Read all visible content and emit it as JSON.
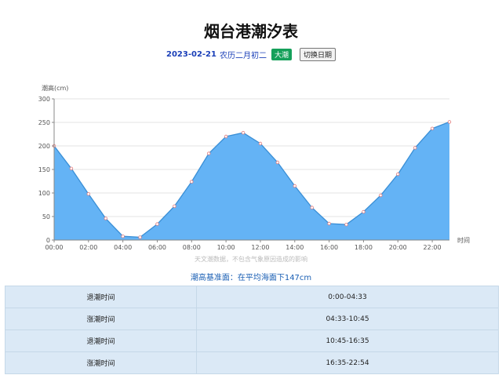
{
  "header": {
    "title": "烟台港潮汐表",
    "date": "2023-02-21",
    "lunar": "农历二月初二",
    "tide_badge": "大潮",
    "switch_button": "切换日期"
  },
  "chart_data": {
    "type": "area",
    "ylabel": "潮高(cm)",
    "xlabel": "时间",
    "ylim": [
      0,
      300
    ],
    "yticks": [
      "0",
      "50",
      "100",
      "150",
      "200",
      "250",
      "300"
    ],
    "xticks": [
      "00:00",
      "02:00",
      "04:00",
      "06:00",
      "08:00",
      "10:00",
      "12:00",
      "14:00",
      "16:00",
      "18:00",
      "20:00",
      "22:00"
    ],
    "x": [
      0,
      1,
      2,
      3,
      4,
      5,
      6,
      7,
      8,
      9,
      10,
      11,
      12,
      13,
      14,
      15,
      16,
      17,
      18,
      19,
      20,
      21,
      22,
      23
    ],
    "values": [
      200,
      152,
      98,
      46,
      8,
      6,
      34,
      72,
      124,
      184,
      220,
      228,
      205,
      165,
      115,
      69,
      35,
      33,
      60,
      95,
      140,
      196,
      237,
      251
    ],
    "fill_color": "#64b3f5",
    "line_color": "#3a8fd6",
    "grid": true
  },
  "footnote": "天文潮数据，不包含气象原因造成的影响",
  "baseline_text": "潮高基准面：在平均海面下147cm",
  "tide_table": [
    {
      "label": "退潮时间",
      "time": "0:00-04:33"
    },
    {
      "label": "涨潮时间",
      "time": "04:33-10:45"
    },
    {
      "label": "退潮时间",
      "time": "10:45-16:35"
    },
    {
      "label": "涨潮时间",
      "time": "16:35-22:54"
    }
  ]
}
